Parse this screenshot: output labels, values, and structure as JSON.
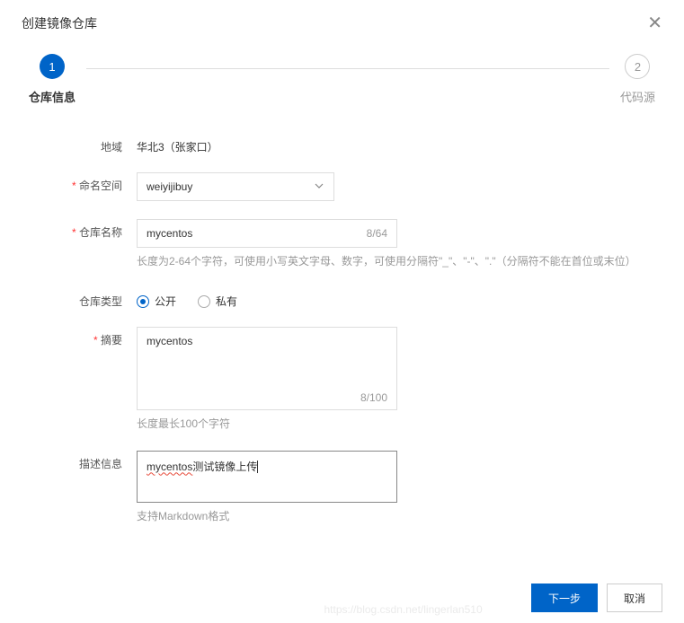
{
  "header": {
    "title": "创建镜像仓库"
  },
  "steps": {
    "step1": {
      "num": "1",
      "label": "仓库信息"
    },
    "step2": {
      "num": "2",
      "label": "代码源"
    }
  },
  "form": {
    "region": {
      "label": "地域",
      "value": "华北3（张家口）"
    },
    "namespace": {
      "label": "命名空间",
      "value": "weiyijibuy"
    },
    "repoName": {
      "label": "仓库名称",
      "value": "mycentos",
      "counter": "8/64",
      "hint": "长度为2-64个字符，可使用小写英文字母、数字，可使用分隔符\"_\"、\"-\"、\".\"（分隔符不能在首位或末位）"
    },
    "repoType": {
      "label": "仓库类型",
      "options": {
        "public": "公开",
        "private": "私有"
      }
    },
    "summary": {
      "label": "摘要",
      "value": "mycentos",
      "counter": "8/100",
      "hint": "长度最长100个字符"
    },
    "description": {
      "label": "描述信息",
      "value_prefix": "mycentos",
      "value_suffix": "测试镜像上传",
      "hint": "支持Markdown格式"
    }
  },
  "footer": {
    "next": "下一步",
    "cancel": "取消"
  },
  "watermark": "https://blog.csdn.net/lingerlan510"
}
